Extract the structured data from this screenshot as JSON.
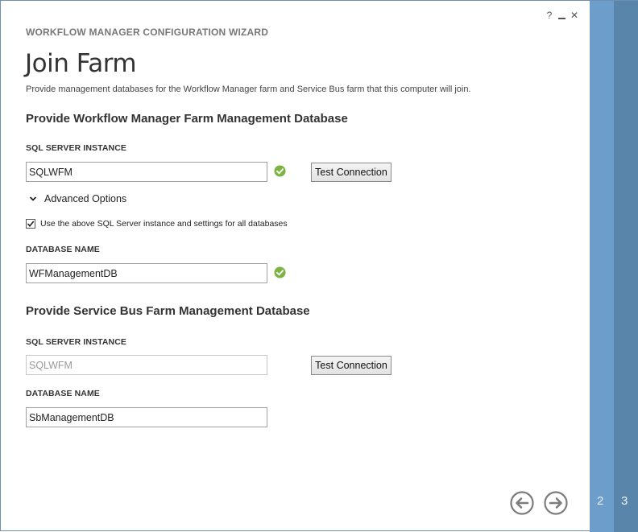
{
  "window": {
    "controls": {
      "help": "?",
      "minimize": "",
      "close": "✕"
    },
    "wizard_title": "WORKFLOW MANAGER CONFIGURATION WIZARD"
  },
  "page": {
    "title": "Join Farm",
    "description": "Provide management databases for the Workflow Manager farm and Service Bus farm that this computer will join."
  },
  "workflow_section": {
    "heading": "Provide Workflow Manager Farm Management Database",
    "sql_label": "SQL SERVER INSTANCE",
    "sql_value": "SQLWFM",
    "test_button": "Test Connection",
    "advanced_options": "Advanced Options",
    "use_settings_checkbox": "Use the above SQL Server instance and settings for all databases",
    "use_settings_checked": true,
    "db_label": "DATABASE NAME",
    "db_value": "WFManagementDB"
  },
  "servicebus_section": {
    "heading": "Provide Service Bus Farm Management Database",
    "sql_label": "SQL SERVER INSTANCE",
    "sql_value": "SQLWFM",
    "test_button": "Test Connection",
    "db_label": "DATABASE NAME",
    "db_value": "SbManagementDB"
  },
  "navigation": {
    "back_icon": "arrow-left-circle-icon",
    "next_icon": "arrow-right-circle-icon"
  },
  "steps": {
    "items": [
      "2",
      "3"
    ]
  },
  "colors": {
    "success": "#7cb342",
    "step_2_bg": "#6d9ecb",
    "step_3_bg": "#5a85aa",
    "accent_text": "#777777"
  }
}
